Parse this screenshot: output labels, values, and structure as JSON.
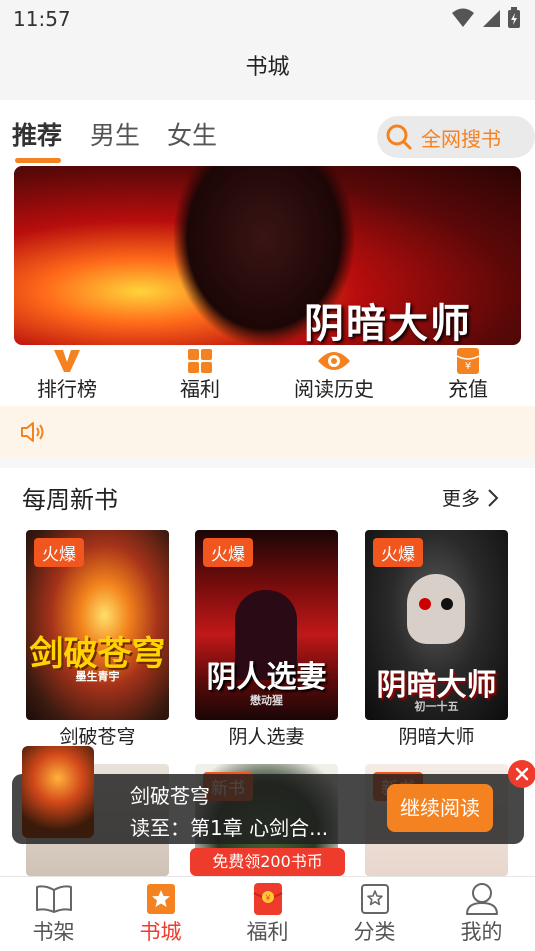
{
  "status_bar": {
    "time": "11:57"
  },
  "title_bar": {
    "title": "书城"
  },
  "tabs": [
    {
      "label": "推荐",
      "active": true
    },
    {
      "label": "男生",
      "active": false
    },
    {
      "label": "女生",
      "active": false
    }
  ],
  "search": {
    "label": "全网搜书"
  },
  "banner": {
    "title": "阴暗大师"
  },
  "quick_nav": [
    {
      "label": "排行榜",
      "icon": "ranking-v-icon"
    },
    {
      "label": "福利",
      "icon": "grid-icon"
    },
    {
      "label": "阅读历史",
      "icon": "eye-icon"
    },
    {
      "label": "充值",
      "icon": "yuan-icon"
    }
  ],
  "weekly": {
    "title": "每周新书",
    "more": "更多",
    "books": [
      {
        "name": "剑破苍穹",
        "tag": "火爆",
        "cover_text": "剑破苍穹",
        "author": "墨生青宇"
      },
      {
        "name": "阴人选妻",
        "tag": "火爆",
        "cover_text": "阴人选妻",
        "author": "懋动猩"
      },
      {
        "name": "阴暗大师",
        "tag": "火爆",
        "cover_text": "阴暗大师",
        "author": "初一十五"
      }
    ],
    "second_row_tags": [
      "新书",
      "新书"
    ]
  },
  "continue_reading": {
    "book_name": "剑破苍穹",
    "progress": "读至：第1章 心剑合...",
    "button": "继续阅读"
  },
  "promo": {
    "label": "免费领200书币"
  },
  "bottom_nav": [
    {
      "label": "书架",
      "icon": "book-icon",
      "active": false
    },
    {
      "label": "书城",
      "icon": "store-star-icon",
      "active": true
    },
    {
      "label": "福利",
      "icon": "red-envelope-icon",
      "active": false
    },
    {
      "label": "分类",
      "icon": "category-icon",
      "active": false
    },
    {
      "label": "我的",
      "icon": "user-icon",
      "active": false
    }
  ],
  "colors": {
    "accent": "#f58220",
    "red": "#ef3b2c"
  }
}
